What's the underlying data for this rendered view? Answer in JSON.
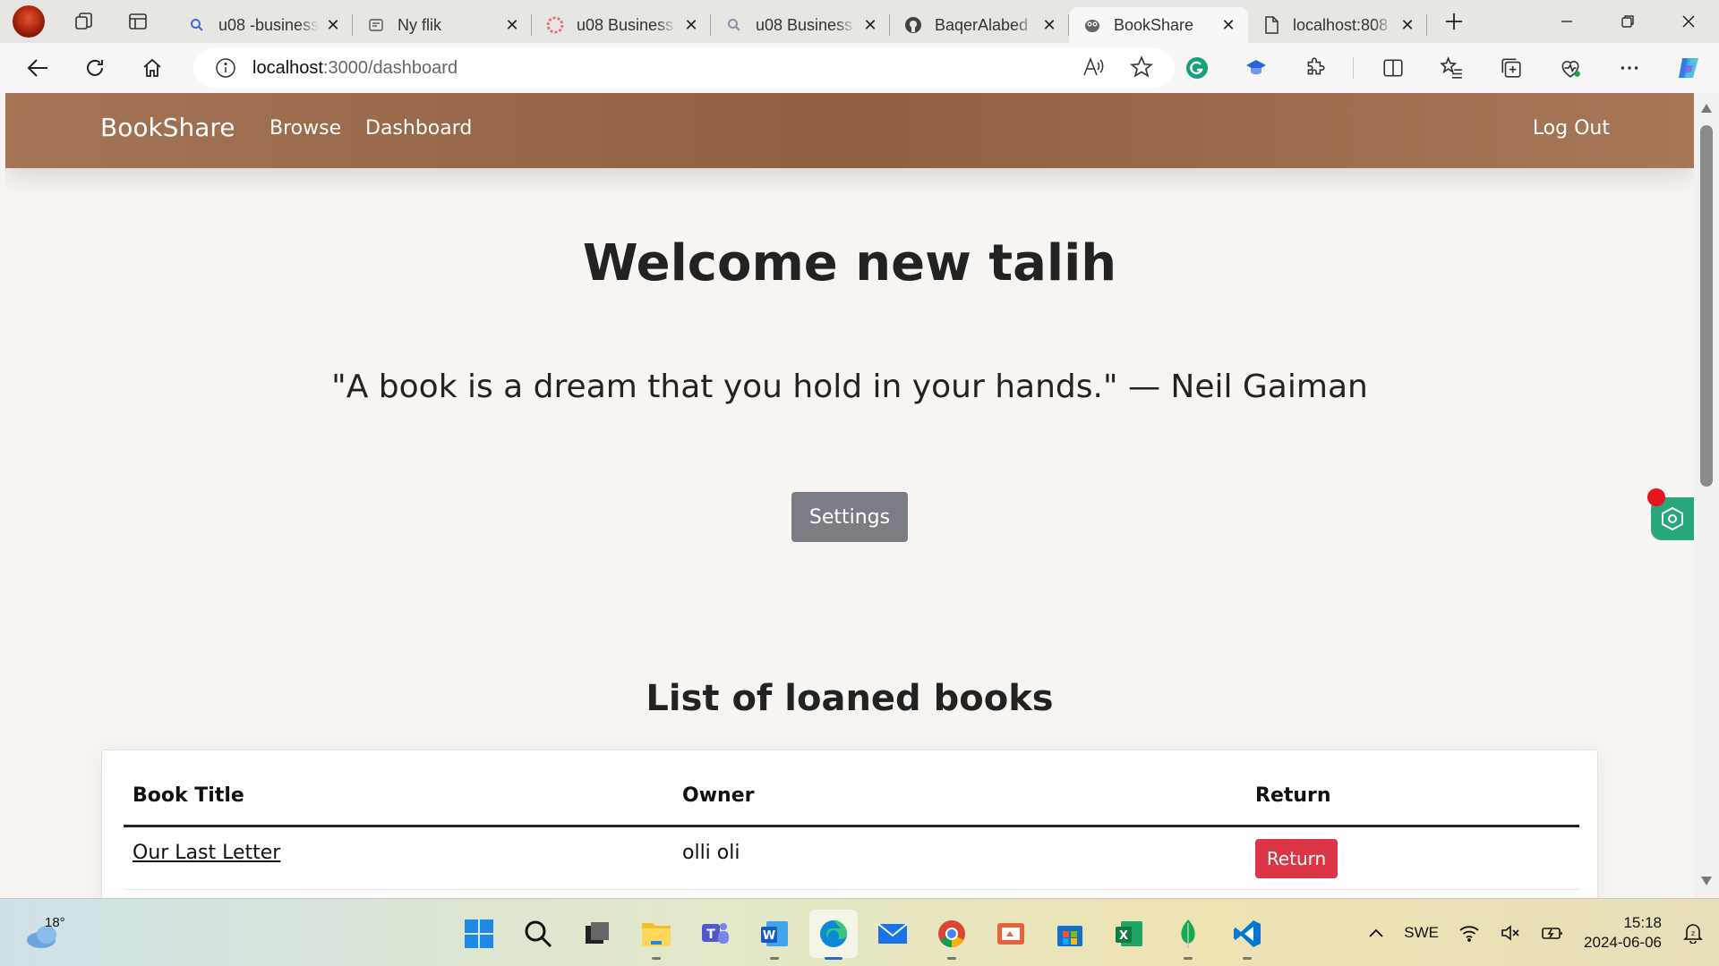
{
  "browser": {
    "tabs": [
      {
        "title": "u08 -business",
        "icon": "search-icon",
        "active": false
      },
      {
        "title": "Ny flik",
        "icon": "new-tab-page-icon",
        "active": false
      },
      {
        "title": "u08 Business",
        "icon": "gear-logo-icon",
        "active": false
      },
      {
        "title": "u08 Business",
        "icon": "search-icon",
        "active": false
      },
      {
        "title": "BaqerAlabed",
        "icon": "github-icon",
        "active": false
      },
      {
        "title": "BookShare",
        "icon": "owl-icon",
        "active": true
      },
      {
        "title": "localhost:808",
        "icon": "document-icon",
        "active": false
      }
    ],
    "address": {
      "host": "localhost",
      "path": ":3000/dashboard"
    }
  },
  "site": {
    "brand": "BookShare",
    "nav": {
      "browse": "Browse",
      "dashboard": "Dashboard",
      "logout": "Log Out"
    },
    "colors": {
      "header": "#9a6b4c",
      "settings_button": "#7c7d84",
      "return_button": "#dc3545"
    }
  },
  "dashboard": {
    "welcome": "Welcome new talih",
    "quote": "\"A book is a dream that you hold in your hands.\" — Neil Gaiman",
    "settings_label": "Settings",
    "list_title": "List of loaned books",
    "table": {
      "headers": [
        "Book Title",
        "Owner",
        "Return"
      ],
      "rows": [
        {
          "title": "Our Last Letter",
          "owner": "olli oli",
          "action": "Return"
        }
      ]
    }
  },
  "taskbar": {
    "weather_temp": "18°",
    "language": "SWE",
    "time": "15:18",
    "date": "2024-06-06"
  }
}
